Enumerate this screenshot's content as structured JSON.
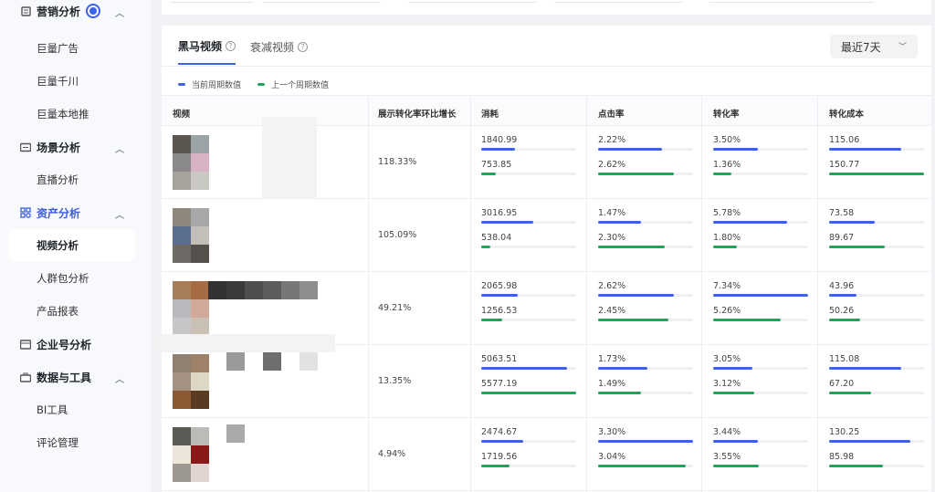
{
  "sidebar": {
    "groups": [
      {
        "label": "营销分析",
        "icon": "doc-icon",
        "items": [
          "巨量广告",
          "巨量千川",
          "巨量本地推"
        ]
      },
      {
        "label": "场景分析",
        "icon": "scene-icon",
        "items": [
          "直播分析"
        ]
      },
      {
        "label": "资产分析",
        "icon": "asset-icon",
        "items": [
          "视频分析",
          "人群包分析",
          "产品报表"
        ]
      },
      {
        "label": "企业号分析",
        "icon": "enterprise-icon",
        "items": []
      },
      {
        "label": "数据与工具",
        "icon": "toolbox-icon",
        "items": [
          "BI工具",
          "评论管理"
        ]
      }
    ],
    "active_item": "视频分析",
    "accent": "#3b5bdb"
  },
  "tabs": [
    {
      "label": "黑马视频",
      "active": true
    },
    {
      "label": "衰减视频",
      "active": false
    }
  ],
  "period_select": {
    "value": "最近7天"
  },
  "legend": {
    "current": {
      "label": "当前周期数值",
      "color": "#3b63e6"
    },
    "previous": {
      "label": "上一个周期数值",
      "color": "#22a45a"
    }
  },
  "columns": {
    "video": "视频",
    "growth": "展示转化率环比增长",
    "spend": "消耗",
    "ctr": "点击率",
    "cvr": "转化率",
    "cost": "转化成本"
  },
  "rows": [
    {
      "growth": "118.33%",
      "spend": {
        "cur": "1840.99",
        "prev": "753.85",
        "cur_pct": 0.36,
        "prev_pct": 0.15
      },
      "ctr": {
        "cur": "2.22%",
        "prev": "2.62%",
        "cur_pct": 0.67,
        "prev_pct": 0.8
      },
      "cvr": {
        "cur": "3.50%",
        "prev": "1.36%",
        "cur_pct": 0.47,
        "prev_pct": 0.19
      },
      "cost": {
        "cur": "115.06",
        "prev": "150.77",
        "cur_pct": 0.76,
        "prev_pct": 1.0
      }
    },
    {
      "growth": "105.09%",
      "spend": {
        "cur": "3016.95",
        "prev": "538.04",
        "cur_pct": 0.55,
        "prev_pct": 0.1
      },
      "ctr": {
        "cur": "1.47%",
        "prev": "2.30%",
        "cur_pct": 0.45,
        "prev_pct": 0.7
      },
      "cvr": {
        "cur": "5.78%",
        "prev": "1.80%",
        "cur_pct": 0.78,
        "prev_pct": 0.25
      },
      "cost": {
        "cur": "73.58",
        "prev": "89.67",
        "cur_pct": 0.48,
        "prev_pct": 0.59
      }
    },
    {
      "growth": "49.21%",
      "spend": {
        "cur": "2065.98",
        "prev": "1256.53",
        "cur_pct": 0.38,
        "prev_pct": 0.22
      },
      "ctr": {
        "cur": "2.62%",
        "prev": "2.45%",
        "cur_pct": 0.8,
        "prev_pct": 0.74
      },
      "cvr": {
        "cur": "7.34%",
        "prev": "5.26%",
        "cur_pct": 1.0,
        "prev_pct": 0.71
      },
      "cost": {
        "cur": "43.96",
        "prev": "50.26",
        "cur_pct": 0.29,
        "prev_pct": 0.33
      }
    },
    {
      "growth": "13.35%",
      "spend": {
        "cur": "5063.51",
        "prev": "5577.19",
        "cur_pct": 0.9,
        "prev_pct": 1.0
      },
      "ctr": {
        "cur": "1.73%",
        "prev": "1.49%",
        "cur_pct": 0.52,
        "prev_pct": 0.45
      },
      "cvr": {
        "cur": "3.05%",
        "prev": "3.12%",
        "cur_pct": 0.41,
        "prev_pct": 0.43
      },
      "cost": {
        "cur": "115.08",
        "prev": "67.20",
        "cur_pct": 0.76,
        "prev_pct": 0.44
      }
    },
    {
      "growth": "4.94%",
      "spend": {
        "cur": "2474.67",
        "prev": "1719.56",
        "cur_pct": 0.44,
        "prev_pct": 0.3
      },
      "ctr": {
        "cur": "3.30%",
        "prev": "3.04%",
        "cur_pct": 1.0,
        "prev_pct": 0.92
      },
      "cvr": {
        "cur": "3.44%",
        "prev": "3.55%",
        "cur_pct": 0.47,
        "prev_pct": 0.48
      },
      "cost": {
        "cur": "130.25",
        "prev": "85.98",
        "cur_pct": 0.86,
        "prev_pct": 0.57
      }
    }
  ],
  "thumb_colors": [
    [
      "#5b574f",
      "#9aa3a6",
      "#8c8a88",
      "#d6b2c2",
      "#a6a29c",
      "#c9c8c3"
    ],
    [
      "#8e877c",
      "#a5a8a6",
      "#5c6e90",
      "#c2bfb8",
      "#6d6a66",
      "#55514d"
    ],
    [
      "#a87e5a",
      "#a66d45",
      "#b8b8bd",
      "#d2a898",
      "#c5c6c8",
      "#c9c1b3"
    ],
    [
      "#908071",
      "#9e8267",
      "#a39282",
      "#ded7c6",
      "#8b5a33",
      "#5a3b22"
    ],
    [
      "#5c5a55",
      "#bcbbb8",
      "#ece6da",
      "#8a1a1a",
      "#9c9791",
      "#e1d5d2"
    ]
  ]
}
